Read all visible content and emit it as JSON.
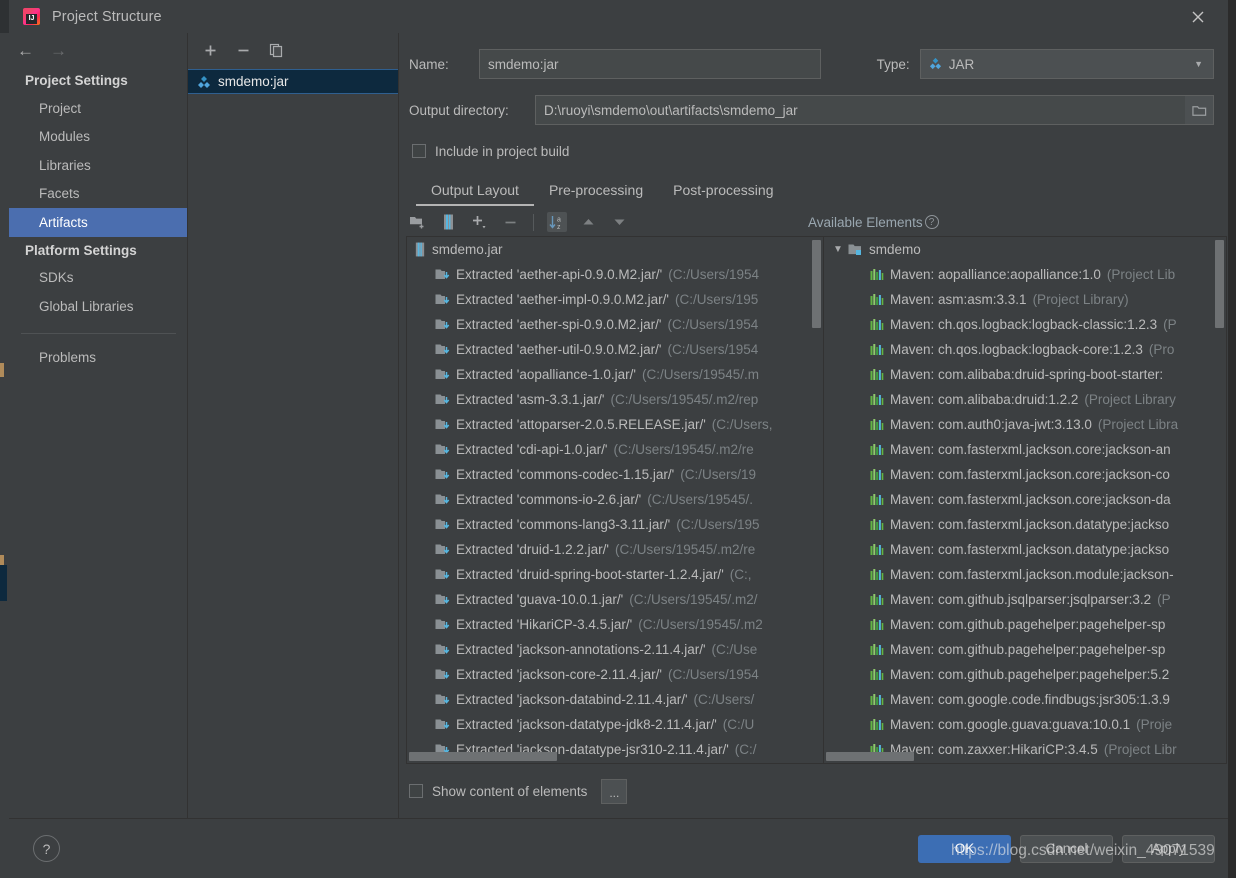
{
  "window": {
    "title": "Project Structure",
    "app_icon": "intellij-idea-icon",
    "close_label": "✕"
  },
  "sidebar": {
    "back_label": "←",
    "forward_label": "→",
    "groups": [
      {
        "title": "Project Settings",
        "items": [
          {
            "label": "Project",
            "selected": false
          },
          {
            "label": "Modules",
            "selected": false
          },
          {
            "label": "Libraries",
            "selected": false
          },
          {
            "label": "Facets",
            "selected": false
          },
          {
            "label": "Artifacts",
            "selected": true
          }
        ]
      },
      {
        "title": "Platform Settings",
        "items": [
          {
            "label": "SDKs",
            "selected": false
          },
          {
            "label": "Global Libraries",
            "selected": false
          }
        ]
      }
    ],
    "extra_items": [
      {
        "label": "Problems",
        "selected": false
      }
    ]
  },
  "artifacts_panel": {
    "toolbar": [
      {
        "name": "add-artifact-button",
        "label": "+"
      },
      {
        "name": "remove-artifact-button",
        "label": "−"
      },
      {
        "name": "copy-artifact-button",
        "label": "copy-icon"
      }
    ],
    "items": [
      {
        "label": "smdemo:jar",
        "icon": "jar-artifact-icon",
        "selected": true
      }
    ]
  },
  "editor": {
    "name_label": "Name:",
    "name_value": "smdemo:jar",
    "type_label": "Type:",
    "type_value": "JAR",
    "type_icon": "jar-artifact-icon",
    "output_dir_label": "Output directory:",
    "output_dir_value": "D:\\ruoyi\\smdemo\\out\\artifacts\\smdemo_jar",
    "browse_icon": "folder-open-icon",
    "include_in_build_label": "Include in project build",
    "include_in_build_checked": false,
    "tabs": [
      {
        "label": "Output Layout",
        "active": true
      },
      {
        "label": "Pre-processing",
        "active": false
      },
      {
        "label": "Post-processing",
        "active": false
      }
    ],
    "layout_toolbar": [
      {
        "name": "create-directory-button",
        "icon": "new-folder-icon"
      },
      {
        "name": "create-archive-button",
        "icon": "archive-icon"
      },
      {
        "name": "add-copy-of-button",
        "icon": "plus-dropdown-icon"
      },
      {
        "name": "remove-element-button",
        "icon": "minus-icon"
      },
      {
        "name": "sort-alphabetically-button",
        "icon": "sort-az-icon",
        "toggled": true
      },
      {
        "name": "move-up-button",
        "icon": "arrow-up-icon"
      },
      {
        "name": "move-down-button",
        "icon": "arrow-down-icon"
      }
    ],
    "available_elements_label": "Available Elements",
    "available_elements_help": "?",
    "show_content_label": "Show content of elements",
    "show_content_checked": false,
    "dots_button_label": "..."
  },
  "output_layout_tree": {
    "root": {
      "label": "smdemo.jar",
      "icon": "archive-icon"
    },
    "children": [
      {
        "label": "Extracted 'aether-api-0.9.0.M2.jar/'",
        "path": "(C:/Users/1954"
      },
      {
        "label": "Extracted 'aether-impl-0.9.0.M2.jar/'",
        "path": "(C:/Users/195"
      },
      {
        "label": "Extracted 'aether-spi-0.9.0.M2.jar/'",
        "path": "(C:/Users/1954"
      },
      {
        "label": "Extracted 'aether-util-0.9.0.M2.jar/'",
        "path": "(C:/Users/1954"
      },
      {
        "label": "Extracted 'aopalliance-1.0.jar/'",
        "path": "(C:/Users/19545/.m"
      },
      {
        "label": "Extracted 'asm-3.3.1.jar/'",
        "path": "(C:/Users/19545/.m2/rep"
      },
      {
        "label": "Extracted 'attoparser-2.0.5.RELEASE.jar/'",
        "path": "(C:/Users,"
      },
      {
        "label": "Extracted 'cdi-api-1.0.jar/'",
        "path": "(C:/Users/19545/.m2/re"
      },
      {
        "label": "Extracted 'commons-codec-1.15.jar/'",
        "path": "(C:/Users/19"
      },
      {
        "label": "Extracted 'commons-io-2.6.jar/'",
        "path": "(C:/Users/19545/."
      },
      {
        "label": "Extracted 'commons-lang3-3.11.jar/'",
        "path": "(C:/Users/195"
      },
      {
        "label": "Extracted 'druid-1.2.2.jar/'",
        "path": "(C:/Users/19545/.m2/re"
      },
      {
        "label": "Extracted 'druid-spring-boot-starter-1.2.4.jar/'",
        "path": "(C:,"
      },
      {
        "label": "Extracted 'guava-10.0.1.jar/'",
        "path": "(C:/Users/19545/.m2/"
      },
      {
        "label": "Extracted 'HikariCP-3.4.5.jar/'",
        "path": "(C:/Users/19545/.m2"
      },
      {
        "label": "Extracted 'jackson-annotations-2.11.4.jar/'",
        "path": "(C:/Use"
      },
      {
        "label": "Extracted 'jackson-core-2.11.4.jar/'",
        "path": "(C:/Users/1954"
      },
      {
        "label": "Extracted 'jackson-databind-2.11.4.jar/'",
        "path": "(C:/Users/"
      },
      {
        "label": "Extracted 'jackson-datatype-jdk8-2.11.4.jar/'",
        "path": "(C:/U"
      },
      {
        "label": "Extracted 'jackson-datatype-jsr310-2.11.4.jar/'",
        "path": "(C:/"
      }
    ]
  },
  "available_elements_tree": {
    "root": {
      "label": "smdemo",
      "icon": "module-folder-icon",
      "expanded": true
    },
    "children": [
      {
        "label": "Maven: aopalliance:aopalliance:1.0",
        "scope": "(Project Lib"
      },
      {
        "label": "Maven: asm:asm:3.3.1",
        "scope": "(Project Library)"
      },
      {
        "label": "Maven: ch.qos.logback:logback-classic:1.2.3",
        "scope": "(P"
      },
      {
        "label": "Maven: ch.qos.logback:logback-core:1.2.3",
        "scope": "(Pro"
      },
      {
        "label": "Maven: com.alibaba:druid-spring-boot-starter:",
        "scope": ""
      },
      {
        "label": "Maven: com.alibaba:druid:1.2.2",
        "scope": "(Project Library"
      },
      {
        "label": "Maven: com.auth0:java-jwt:3.13.0",
        "scope": "(Project Libra"
      },
      {
        "label": "Maven: com.fasterxml.jackson.core:jackson-an",
        "scope": ""
      },
      {
        "label": "Maven: com.fasterxml.jackson.core:jackson-co",
        "scope": ""
      },
      {
        "label": "Maven: com.fasterxml.jackson.core:jackson-da",
        "scope": ""
      },
      {
        "label": "Maven: com.fasterxml.jackson.datatype:jackso",
        "scope": ""
      },
      {
        "label": "Maven: com.fasterxml.jackson.datatype:jackso",
        "scope": ""
      },
      {
        "label": "Maven: com.fasterxml.jackson.module:jackson-",
        "scope": ""
      },
      {
        "label": "Maven: com.github.jsqlparser:jsqlparser:3.2",
        "scope": "(P"
      },
      {
        "label": "Maven: com.github.pagehelper:pagehelper-sp",
        "scope": ""
      },
      {
        "label": "Maven: com.github.pagehelper:pagehelper-sp",
        "scope": ""
      },
      {
        "label": "Maven: com.github.pagehelper:pagehelper:5.2",
        "scope": ""
      },
      {
        "label": "Maven: com.google.code.findbugs:jsr305:1.3.9",
        "scope": ""
      },
      {
        "label": "Maven: com.google.guava:guava:10.0.1",
        "scope": "(Proje"
      },
      {
        "label": "Maven: com.zaxxer:HikariCP:3.4.5",
        "scope": "(Project Libr"
      }
    ]
  },
  "footer": {
    "help_label": "?",
    "ok_label": "OK",
    "cancel_label": "Cancel",
    "apply_label": "Apply"
  },
  "watermark": {
    "text": "https://blog.csdn.net/weixin_49071539"
  },
  "colors": {
    "dialog_bg": "#3c3f41",
    "selection_blue": "#4b6eaf",
    "tree_selection": "#0d293e",
    "primary_button": "#3c6eb4",
    "text": "#bbbbbb",
    "muted_text": "#7c8285",
    "available_label": "#9aa7b0"
  }
}
